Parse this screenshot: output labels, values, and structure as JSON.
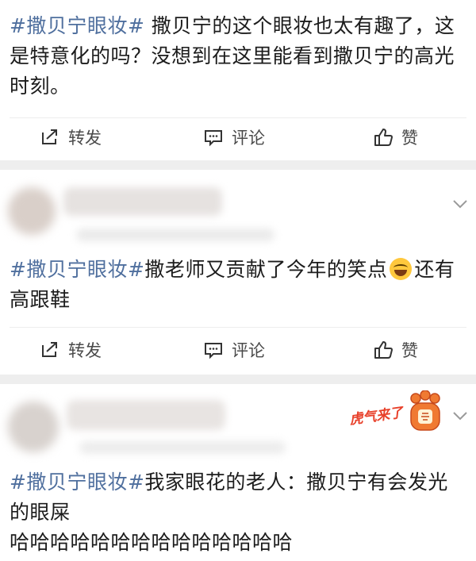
{
  "posts": [
    {
      "hashtag": "#撒贝宁眼妆#",
      "text_line1": " 撒贝宁的这个眼妆也太有趣了，这",
      "text_line2": "是特意化的吗？没想到在这里能看到撒贝宁的高光",
      "text_line3": "时刻。"
    },
    {
      "hashtag": "#撒贝宁眼妆#",
      "text_line1": "撒老师又贡献了今年的笑点",
      "text_line1_after": "还有",
      "text_line2": "高跟鞋",
      "emoji": "laughing-face"
    },
    {
      "hashtag": "#撒贝宁眼妆#",
      "text_line1": "我家眼花的老人：撒贝宁有会发光",
      "text_line2": "的眼屎",
      "text_line3": "哈哈哈哈哈哈哈哈哈哈哈哈哈哈"
    }
  ],
  "actions": {
    "forward": "转发",
    "comment": "评论",
    "like": "赞"
  },
  "badge": {
    "text": "虎气来了"
  },
  "colors": {
    "hashtag": "#4f6f9e",
    "text": "#1c1c1c",
    "action_text": "#4a4a4a",
    "separator": "#eeeeee",
    "badge_red": "#e8402a"
  }
}
